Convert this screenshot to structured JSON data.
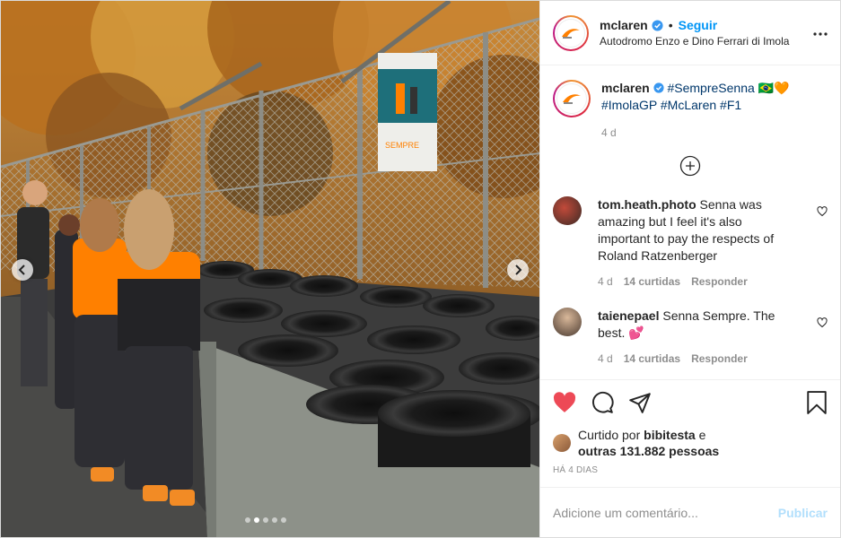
{
  "post": {
    "username": "mclaren",
    "follow_label": "Seguir",
    "separator": "•",
    "location": "Autodromo Enzo e Dino Ferrari di Imola",
    "caption": {
      "username": "mclaren",
      "text": "#SempreSenna 🇧🇷🧡",
      "hashtags_line2": "#ImolaGP #McLaren #F1",
      "age": "4 d"
    },
    "banner_text": "SEMPRE"
  },
  "comments": [
    {
      "username": "tom.heath.photo",
      "text": "Senna was amazing but I feel it's also important to pay the respects of Roland Ratzenberger",
      "age": "4 d",
      "likes": "14 curtidas",
      "reply": "Responder"
    },
    {
      "username": "taienepael",
      "text": "Senna Sempre. The best. 💕",
      "age": "4 d",
      "likes": "14 curtidas",
      "reply": "Responder"
    }
  ],
  "likes": {
    "prefix": "Curtido por",
    "user": "bibitesta",
    "connector": "e",
    "others": "outras 131.882 pessoas"
  },
  "date": "HÁ 4 DIAS",
  "add_comment": {
    "placeholder": "Adicione um comentário...",
    "publish": "Publicar"
  },
  "icons": {
    "like": "heart-filled-icon",
    "comment": "comment-icon",
    "share": "paper-plane-icon",
    "save": "bookmark-icon",
    "more": "more-horizontal-icon",
    "load_more": "plus-circle-icon"
  },
  "colors": {
    "like_red": "#ed4956",
    "follow_blue": "#0095f6",
    "publish_disabled": "#b2dffc",
    "mclaren_orange": "#ff8000"
  },
  "carousel": {
    "slides": 5,
    "active": 1
  }
}
